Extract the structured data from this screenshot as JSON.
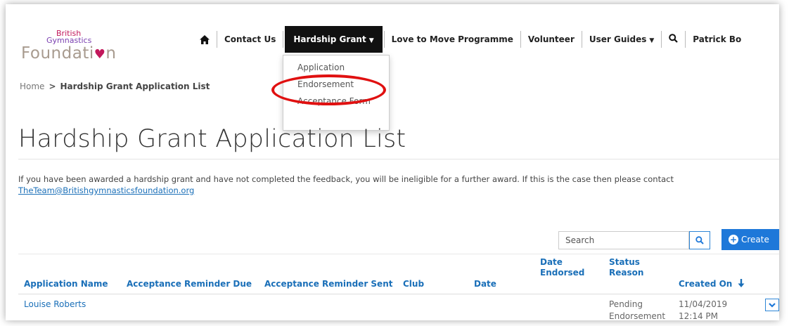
{
  "logo": {
    "line1": "British",
    "line2": "Gymnastics",
    "line3_a": "Foundati",
    "line3_heart": "♥",
    "line3_b": "n"
  },
  "nav": {
    "contact_us": "Contact Us",
    "hardship_grant": "Hardship Grant",
    "love_to_move": "Love to Move Programme",
    "volunteer": "Volunteer",
    "user_guides": "User Guides",
    "user_name": "Patrick Bo"
  },
  "dropdown": {
    "items": [
      "Application",
      "Endorsement",
      "Acceptance Form"
    ]
  },
  "breadcrumb": {
    "home": "Home",
    "separator": ">",
    "current": "Hardship Grant Application List"
  },
  "page_title": "Hardship Grant Application List",
  "info": {
    "text": "If you have been awarded a hardship grant and have not completed the feedback, you will be ineligible for a further award. If this is the case then please contact",
    "email": "TheTeam@Britishgymnasticsfoundation.org"
  },
  "search": {
    "placeholder": "Search"
  },
  "create_label": "Create",
  "table": {
    "headers": {
      "application_name": "Application Name",
      "acceptance_reminder_due": "Acceptance Reminder Due",
      "acceptance_reminder_sent": "Acceptance Reminder Sent",
      "club": "Club",
      "date": "Date",
      "date_endorsed_1": "Date",
      "date_endorsed_2": "Endorsed",
      "status_reason_1": "Status",
      "status_reason_2": "Reason",
      "created_on": "Created On"
    },
    "rows": [
      {
        "application_name": "Louise Roberts",
        "status_1": "Pending",
        "status_2": "Endorsement",
        "created_date": "11/04/2019",
        "created_time": "12:14 PM"
      }
    ]
  },
  "colors": {
    "accent": "#1e78d9",
    "link": "#1a6fb8",
    "highlight": "#e01010",
    "nav_active": "#111111"
  }
}
